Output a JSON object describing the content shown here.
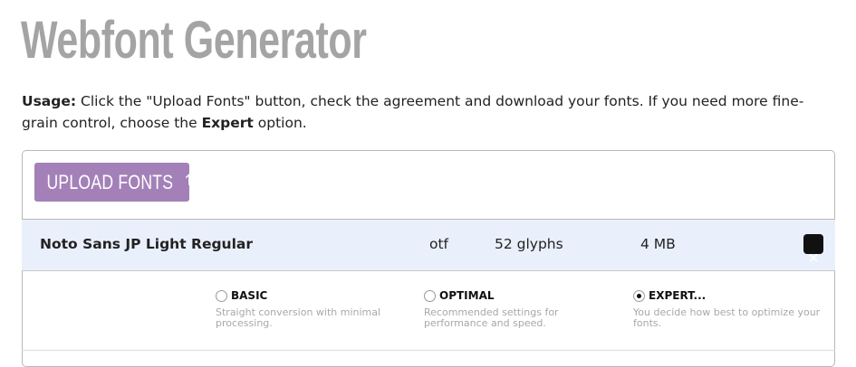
{
  "page": {
    "title": "Webfont Generator"
  },
  "usage": {
    "label": "Usage:",
    "text_1": " Click the \"Upload Fonts\" button, check the agreement and download your fonts. If you need more fine-grain control, choose the ",
    "expert_word": "Expert",
    "text_2": " option."
  },
  "upload": {
    "label": "UPLOAD FONTS",
    "icon": "arrow-up-icon"
  },
  "font": {
    "name": "Noto Sans JP Light Regular",
    "type": "otf",
    "glyphs": "52 glyphs",
    "size": "4 MB",
    "remove_icon": "close-icon"
  },
  "options": [
    {
      "label": "BASIC",
      "desc": "Straight conversion with minimal processing.",
      "checked": false
    },
    {
      "label": "OPTIMAL",
      "desc": "Recommended settings for performance and speed.",
      "checked": false
    },
    {
      "label": "EXPERT...",
      "desc": "You decide how best to optimize your fonts.",
      "checked": true
    }
  ]
}
